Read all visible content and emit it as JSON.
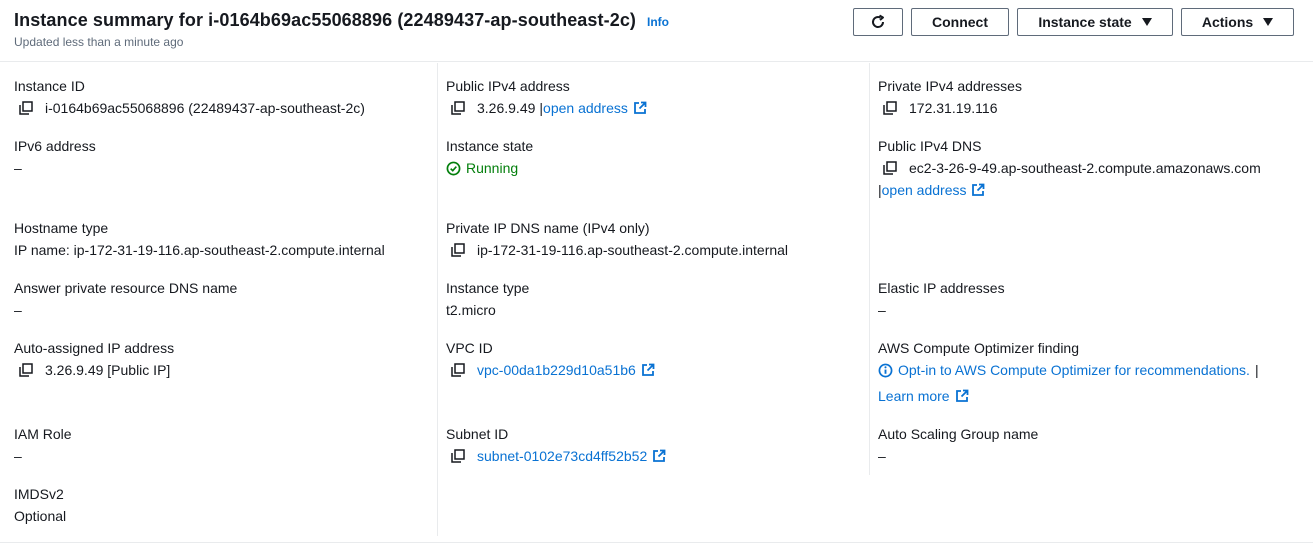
{
  "header": {
    "title": "Instance summary for i-0164b69ac55068896 (22489437-ap-southeast-2c)",
    "info": "Info",
    "updated": "Updated less than a minute ago",
    "buttons": {
      "connect": "Connect",
      "instance_state": "Instance state",
      "actions": "Actions"
    }
  },
  "col1": {
    "instance_id": {
      "label": "Instance ID",
      "value": "i-0164b69ac55068896 (22489437-ap-southeast-2c)"
    },
    "ipv6": {
      "label": "IPv6 address",
      "value": "–"
    },
    "hostname_type": {
      "label": "Hostname type",
      "value": "IP name: ip-172-31-19-116.ap-southeast-2.compute.internal"
    },
    "answer_dns": {
      "label": "Answer private resource DNS name",
      "value": "–"
    },
    "auto_ip": {
      "label": "Auto-assigned IP address",
      "value": "3.26.9.49 [Public IP]"
    },
    "iam_role": {
      "label": "IAM Role",
      "value": "–"
    },
    "imdsv2": {
      "label": "IMDSv2",
      "value": "Optional"
    }
  },
  "col2": {
    "public_ipv4": {
      "label": "Public IPv4 address",
      "value": "3.26.9.49",
      "separator": "|",
      "link": "open address"
    },
    "instance_state": {
      "label": "Instance state",
      "value": "Running"
    },
    "private_dns": {
      "label": "Private IP DNS name (IPv4 only)",
      "value": "ip-172-31-19-116.ap-southeast-2.compute.internal"
    },
    "instance_type": {
      "label": "Instance type",
      "value": "t2.micro"
    },
    "vpc": {
      "label": "VPC ID",
      "value": "vpc-00da1b229d10a51b6"
    },
    "subnet": {
      "label": "Subnet ID",
      "value": "subnet-0102e73cd4ff52b52"
    }
  },
  "col3": {
    "private_ipv4": {
      "label": "Private IPv4 addresses",
      "value": "172.31.19.116"
    },
    "public_dns": {
      "label": "Public IPv4 DNS",
      "value": "ec2-3-26-9-49.ap-southeast-2.compute.amazonaws.com",
      "separator": "|",
      "link": "open address"
    },
    "elastic_ip": {
      "label": "Elastic IP addresses",
      "value": "–"
    },
    "optimizer": {
      "label": "AWS Compute Optimizer finding",
      "value": "Opt-in to AWS Compute Optimizer for recommendations.",
      "separator": "|",
      "learn_more": "Learn more"
    },
    "asg": {
      "label": "Auto Scaling Group name",
      "value": "–"
    }
  },
  "colors": {
    "link": "#0972d3",
    "running": "#037f0c",
    "text": "#16191f",
    "muted": "#5f6b7a",
    "divider": "#e9ebed"
  },
  "icons": [
    "refresh-icon",
    "caret-down-icon",
    "copy-icon",
    "external-link-icon",
    "status-success-icon",
    "info-circle-icon"
  ]
}
